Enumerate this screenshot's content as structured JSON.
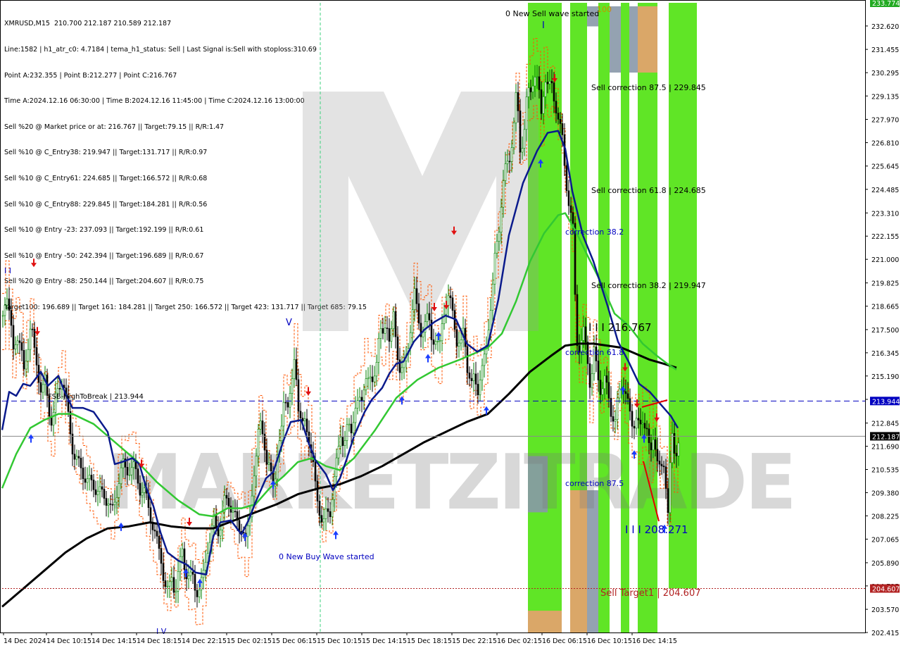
{
  "info_lines": [
    "XMRUSD,M15  210.700 212.187 210.589 212.187",
    "Line:1582 | h1_atr_c0: 4.7184 | tema_h1_status: Sell | Last Signal is:Sell with stoploss:310.69",
    "Point A:232.355 | Point B:212.277 | Point C:216.767",
    "Time A:2024.12.16 06:30:00 | Time B:2024.12.16 11:45:00 | Time C:2024.12.16 13:00:00",
    "Sell %20 @ Market price or at: 216.767 || Target:79.15 || R/R:1.47",
    "Sell %10 @ C_Entry38: 219.947 || Target:131.717 || R/R:0.97",
    "Sell %10 @ C_Entry61: 224.685 || Target:166.572 || R/R:0.68",
    "Sell %10 @ C_Entry88: 229.845 || Target:184.281 || R/R:0.56",
    "Sell %10 @ Entry -23: 237.093 || Target:192.199 || R/R:0.61",
    "Sell %10 @ Entry -50: 242.394 || Target:196.689 || R/R:0.67",
    "Sell %20 @ Entry -88: 250.144 || Target:204.607 || R/R:0.75",
    "Target100: 196.689 || Target 161: 184.281 || Target 250: 166.572 || Target 423: 131.717 || Target 685: 79.15"
  ],
  "chart_data": {
    "type": "candlestick",
    "symbol": "XMRUSD",
    "timeframe": "M15",
    "ylim": [
      202.415,
      233.774
    ],
    "y_ticks": [
      "232.620",
      "231.455",
      "230.295",
      "229.135",
      "227.970",
      "226.810",
      "225.645",
      "224.485",
      "223.310",
      "222.155",
      "221.000",
      "219.825",
      "218.665",
      "217.500",
      "216.345",
      "215.190",
      "214.025",
      "212.845",
      "211.690",
      "210.535",
      "209.380",
      "208.225",
      "207.065",
      "205.890",
      "204.735",
      "203.570",
      "202.415"
    ],
    "x_ticks": [
      "14 Dec 2024",
      "14 Dec 10:15",
      "14 Dec 14:15",
      "14 Dec 18:15",
      "14 Dec 22:15",
      "15 Dec 02:15",
      "15 Dec 06:15",
      "15 Dec 10:15",
      "15 Dec 14:15",
      "15 Dec 18:15",
      "15 Dec 22:15",
      "16 Dec 02:15",
      "16 Dec 06:15",
      "16 Dec 10:15",
      "16 Dec 14:15"
    ],
    "price_labels": {
      "top": "233.774",
      "resistance": "213.944",
      "current": "212.187",
      "target": "204.607"
    },
    "levels": {
      "resistance": 213.944,
      "current": 212.187,
      "target": 204.607
    },
    "annotations": {
      "new_sell": "0 New Sell wave started",
      "new_buy": "0 New Buy Wave started",
      "fsb": "FSB-HighToBreak | 213.944",
      "sell_corr_875": "Sell correction 87.5 | 229.845",
      "sell_corr_618": "Sell correction 61.8 | 224.685",
      "sell_corr_382": "Sell correction 38.2 | 219.947",
      "corr_382": "correction 38.2",
      "corr_618": "correction 61.8",
      "corr_875": "correction 87.5",
      "point_c": "I I I 216.767",
      "point_b": "I I I 208.271",
      "sell_target": "Sell Target1 | 204.607",
      "top_marker": "100",
      "watermark": "MARKETZITRADE"
    },
    "close_series": [
      [
        0,
        218.2
      ],
      [
        5,
        219.6
      ],
      [
        10,
        218.0
      ],
      [
        15,
        216.4
      ],
      [
        20,
        217.4
      ],
      [
        25,
        216.7
      ],
      [
        30,
        215.3
      ],
      [
        35,
        216.6
      ],
      [
        40,
        217.9
      ],
      [
        45,
        216.3
      ],
      [
        50,
        215.4
      ],
      [
        55,
        214.4
      ],
      [
        60,
        214.9
      ],
      [
        65,
        213.6
      ],
      [
        70,
        212.9
      ],
      [
        75,
        214.0
      ],
      [
        80,
        214.6
      ],
      [
        85,
        215.2
      ],
      [
        90,
        213.9
      ],
      [
        95,
        212.6
      ],
      [
        100,
        211.4
      ],
      [
        110,
        210.6
      ],
      [
        120,
        210.0
      ],
      [
        130,
        209.7
      ],
      [
        140,
        209.3
      ],
      [
        150,
        209.0
      ],
      [
        155,
        208.3
      ],
      [
        160,
        209.0
      ],
      [
        165,
        210.1
      ],
      [
        170,
        210.8
      ],
      [
        175,
        210.4
      ],
      [
        180,
        210.6
      ],
      [
        185,
        210.7
      ],
      [
        190,
        210.2
      ],
      [
        195,
        209.6
      ],
      [
        200,
        209.5
      ],
      [
        205,
        208.9
      ],
      [
        210,
        208.2
      ],
      [
        215,
        207.5
      ],
      [
        220,
        206.7
      ],
      [
        225,
        206.1
      ],
      [
        230,
        204.8
      ],
      [
        235,
        204.3
      ],
      [
        240,
        205.3
      ],
      [
        245,
        204.4
      ],
      [
        250,
        205.4
      ],
      [
        255,
        206.6
      ],
      [
        260,
        205.4
      ],
      [
        265,
        205.0
      ],
      [
        270,
        205.2
      ],
      [
        275,
        204.5
      ],
      [
        280,
        204.5
      ],
      [
        285,
        205.3
      ],
      [
        290,
        206.6
      ],
      [
        295,
        207.1
      ],
      [
        300,
        208.0
      ],
      [
        305,
        207.5
      ],
      [
        310,
        207.8
      ],
      [
        315,
        208.9
      ],
      [
        320,
        209.1
      ],
      [
        325,
        208.6
      ],
      [
        330,
        208.1
      ],
      [
        335,
        207.6
      ],
      [
        340,
        207.8
      ],
      [
        345,
        206.9
      ],
      [
        350,
        207.8
      ],
      [
        355,
        210.0
      ],
      [
        360,
        211.0
      ],
      [
        365,
        213.0
      ],
      [
        370,
        212.5
      ],
      [
        375,
        210.7
      ],
      [
        380,
        210.4
      ],
      [
        385,
        209.8
      ],
      [
        390,
        211.3
      ],
      [
        395,
        211.9
      ],
      [
        400,
        214.5
      ],
      [
        405,
        213.8
      ],
      [
        410,
        214.3
      ],
      [
        415,
        216.4
      ],
      [
        420,
        213.7
      ],
      [
        425,
        212.5
      ],
      [
        430,
        213.0
      ],
      [
        435,
        212.1
      ],
      [
        440,
        210.9
      ],
      [
        445,
        209.4
      ],
      [
        450,
        208.6
      ],
      [
        455,
        207.7
      ],
      [
        460,
        208.4
      ],
      [
        465,
        208.5
      ],
      [
        470,
        209.8
      ],
      [
        475,
        211.0
      ],
      [
        480,
        212.4
      ],
      [
        485,
        211.8
      ],
      [
        490,
        212.6
      ],
      [
        495,
        212.5
      ],
      [
        500,
        213.7
      ],
      [
        505,
        213.7
      ],
      [
        510,
        214.0
      ],
      [
        515,
        215.4
      ],
      [
        520,
        214.8
      ],
      [
        525,
        214.8
      ],
      [
        530,
        215.9
      ],
      [
        535,
        217.3
      ],
      [
        540,
        217.1
      ],
      [
        545,
        218.2
      ],
      [
        550,
        216.7
      ],
      [
        555,
        218.1
      ],
      [
        560,
        216.6
      ],
      [
        565,
        215.3
      ],
      [
        570,
        215.6
      ],
      [
        575,
        216.6
      ],
      [
        580,
        217.9
      ],
      [
        585,
        219.2
      ],
      [
        590,
        218.2
      ],
      [
        595,
        217.3
      ],
      [
        600,
        217.6
      ],
      [
        605,
        218.3
      ],
      [
        610,
        217.1
      ],
      [
        615,
        216.7
      ],
      [
        620,
        216.5
      ],
      [
        625,
        218.5
      ],
      [
        630,
        218.6
      ],
      [
        635,
        219.0
      ],
      [
        640,
        218.6
      ],
      [
        645,
        216.7
      ],
      [
        650,
        216.4
      ],
      [
        655,
        218.0
      ],
      [
        660,
        215.5
      ],
      [
        665,
        214.4
      ],
      [
        670,
        215.5
      ],
      [
        675,
        214.5
      ],
      [
        680,
        215.1
      ],
      [
        685,
        216.4
      ],
      [
        690,
        217.8
      ],
      [
        695,
        218.9
      ],
      [
        700,
        221.6
      ],
      [
        705,
        222.7
      ],
      [
        710,
        224.4
      ],
      [
        715,
        225.7
      ],
      [
        720,
        226.2
      ],
      [
        725,
        227.2
      ],
      [
        730,
        229.4
      ],
      [
        735,
        226.6
      ],
      [
        740,
        227.0
      ],
      [
        745,
        229.2
      ],
      [
        750,
        229.5
      ],
      [
        755,
        230.3
      ],
      [
        760,
        229.7
      ],
      [
        765,
        228.3
      ],
      [
        770,
        230.2
      ],
      [
        775,
        229.4
      ],
      [
        780,
        229.7
      ],
      [
        785,
        228.8
      ],
      [
        790,
        227.7
      ],
      [
        795,
        227.0
      ],
      [
        800,
        225.1
      ],
      [
        805,
        223.4
      ],
      [
        810,
        222.5
      ],
      [
        815,
        217.2
      ],
      [
        820,
        216.4
      ],
      [
        825,
        217.3
      ],
      [
        830,
        216.5
      ],
      [
        835,
        214.5
      ],
      [
        840,
        216.3
      ],
      [
        845,
        215.4
      ],
      [
        850,
        214.4
      ],
      [
        855,
        214.9
      ],
      [
        860,
        214.4
      ],
      [
        865,
        213.3
      ],
      [
        870,
        212.8
      ],
      [
        875,
        214.4
      ],
      [
        880,
        215.0
      ],
      [
        885,
        214.2
      ],
      [
        890,
        213.4
      ],
      [
        895,
        212.8
      ],
      [
        900,
        213.1
      ],
      [
        905,
        212.4
      ],
      [
        910,
        213.1
      ],
      [
        915,
        212.7
      ],
      [
        920,
        210.9
      ],
      [
        925,
        212.3
      ],
      [
        930,
        211.2
      ],
      [
        935,
        210.3
      ],
      [
        940,
        210.6
      ],
      [
        945,
        208.7
      ],
      [
        950,
        212.3
      ],
      [
        955,
        210.8
      ],
      [
        960,
        212.2
      ]
    ],
    "tema_series": [
      [
        0,
        212.5
      ],
      [
        10,
        214.4
      ],
      [
        20,
        214.2
      ],
      [
        30,
        214.8
      ],
      [
        40,
        214.7
      ],
      [
        55,
        215.4
      ],
      [
        65,
        214.7
      ],
      [
        80,
        215.2
      ],
      [
        90,
        214.3
      ],
      [
        100,
        213.6
      ],
      [
        115,
        213.6
      ],
      [
        130,
        213.4
      ],
      [
        150,
        212.4
      ],
      [
        160,
        210.8
      ],
      [
        170,
        210.9
      ],
      [
        185,
        211.1
      ],
      [
        195,
        210.8
      ],
      [
        205,
        209.6
      ],
      [
        215,
        208.7
      ],
      [
        225,
        207.4
      ],
      [
        235,
        206.4
      ],
      [
        250,
        206.0
      ],
      [
        262,
        205.8
      ],
      [
        275,
        205.4
      ],
      [
        290,
        205.3
      ],
      [
        300,
        207.2
      ],
      [
        310,
        207.9
      ],
      [
        325,
        208.0
      ],
      [
        340,
        207.3
      ],
      [
        350,
        208.0
      ],
      [
        360,
        208.9
      ],
      [
        375,
        210.1
      ],
      [
        385,
        210.4
      ],
      [
        400,
        212.0
      ],
      [
        410,
        212.9
      ],
      [
        425,
        213.0
      ],
      [
        435,
        211.9
      ],
      [
        445,
        211.0
      ],
      [
        460,
        210.3
      ],
      [
        470,
        209.5
      ],
      [
        480,
        210.1
      ],
      [
        490,
        211.1
      ],
      [
        500,
        212.2
      ],
      [
        515,
        213.4
      ],
      [
        525,
        214.0
      ],
      [
        540,
        214.6
      ],
      [
        550,
        215.3
      ],
      [
        560,
        215.8
      ],
      [
        570,
        215.9
      ],
      [
        585,
        216.9
      ],
      [
        600,
        217.5
      ],
      [
        615,
        217.9
      ],
      [
        630,
        218.2
      ],
      [
        645,
        218.0
      ],
      [
        660,
        216.8
      ],
      [
        675,
        216.4
      ],
      [
        690,
        216.7
      ],
      [
        705,
        219.0
      ],
      [
        720,
        222.2
      ],
      [
        740,
        224.8
      ],
      [
        760,
        226.4
      ],
      [
        775,
        227.3
      ],
      [
        790,
        227.4
      ],
      [
        800,
        226.5
      ],
      [
        810,
        224.4
      ],
      [
        825,
        222.2
      ],
      [
        840,
        220.9
      ],
      [
        860,
        218.7
      ],
      [
        875,
        216.9
      ],
      [
        890,
        215.9
      ],
      [
        905,
        214.8
      ],
      [
        920,
        214.4
      ],
      [
        935,
        213.8
      ],
      [
        950,
        213.2
      ],
      [
        960,
        212.6
      ]
    ],
    "ma_green_series": [
      [
        0,
        209.6
      ],
      [
        20,
        211.3
      ],
      [
        40,
        212.6
      ],
      [
        60,
        213.0
      ],
      [
        80,
        213.3
      ],
      [
        100,
        213.3
      ],
      [
        130,
        212.8
      ],
      [
        160,
        211.9
      ],
      [
        190,
        211.0
      ],
      [
        220,
        209.9
      ],
      [
        250,
        209.0
      ],
      [
        280,
        208.3
      ],
      [
        300,
        208.2
      ],
      [
        320,
        208.6
      ],
      [
        340,
        208.6
      ],
      [
        360,
        208.8
      ],
      [
        380,
        209.6
      ],
      [
        400,
        210.2
      ],
      [
        420,
        210.9
      ],
      [
        440,
        211.1
      ],
      [
        460,
        210.7
      ],
      [
        480,
        210.5
      ],
      [
        500,
        211.1
      ],
      [
        530,
        212.5
      ],
      [
        560,
        214.1
      ],
      [
        590,
        215.0
      ],
      [
        620,
        215.6
      ],
      [
        650,
        216.0
      ],
      [
        670,
        216.3
      ],
      [
        690,
        216.6
      ],
      [
        710,
        217.3
      ],
      [
        730,
        218.9
      ],
      [
        750,
        220.9
      ],
      [
        770,
        222.3
      ],
      [
        790,
        223.2
      ],
      [
        800,
        223.3
      ],
      [
        815,
        222.4
      ],
      [
        830,
        221.3
      ],
      [
        850,
        219.9
      ],
      [
        870,
        218.3
      ],
      [
        890,
        217.7
      ],
      [
        910,
        216.8
      ],
      [
        930,
        216.2
      ],
      [
        945,
        215.8
      ],
      [
        958,
        215.5
      ]
    ],
    "ma_black_series": [
      [
        0,
        203.7
      ],
      [
        30,
        204.6
      ],
      [
        60,
        205.5
      ],
      [
        90,
        206.4
      ],
      [
        120,
        207.1
      ],
      [
        150,
        207.6
      ],
      [
        180,
        207.7
      ],
      [
        210,
        207.9
      ],
      [
        240,
        207.7
      ],
      [
        270,
        207.6
      ],
      [
        300,
        207.6
      ],
      [
        330,
        208.0
      ],
      [
        360,
        208.4
      ],
      [
        390,
        208.8
      ],
      [
        420,
        209.3
      ],
      [
        450,
        209.6
      ],
      [
        480,
        209.8
      ],
      [
        510,
        210.2
      ],
      [
        540,
        210.7
      ],
      [
        570,
        211.3
      ],
      [
        600,
        211.9
      ],
      [
        630,
        212.4
      ],
      [
        660,
        212.9
      ],
      [
        690,
        213.3
      ],
      [
        720,
        214.3
      ],
      [
        750,
        215.4
      ],
      [
        780,
        216.2
      ],
      [
        800,
        216.7
      ],
      [
        820,
        216.8
      ],
      [
        840,
        216.8
      ],
      [
        860,
        216.7
      ],
      [
        880,
        216.6
      ],
      [
        900,
        216.3
      ],
      [
        920,
        216.0
      ],
      [
        940,
        215.8
      ],
      [
        958,
        215.6
      ]
    ],
    "vertical_bands": [
      {
        "x1": 750,
        "x2": 798,
        "color": "#44e000"
      },
      {
        "x1": 810,
        "x2": 834,
        "color": "#44e000"
      },
      {
        "x1": 850,
        "x2": 866,
        "color": "#44e000"
      },
      {
        "x1": 882,
        "x2": 894,
        "color": "#44e000"
      },
      {
        "x1": 906,
        "x2": 934,
        "color": "#44e000"
      },
      {
        "x1": 950,
        "x2": 990,
        "color": "#44e000",
        "y_min": 204.607
      }
    ],
    "colors": {
      "bull_candle": "#008000",
      "bear_candle": "#000000",
      "tema": "#0a1a8c",
      "ma_green": "#32c832",
      "ma_black": "#000000",
      "resistance_line": "#0000c0",
      "target_line": "#b22222",
      "orange_channel": "#ff5500",
      "price_box_blue": "#0000c0",
      "price_box_red": "#b22222",
      "grid": "#c0c0c0"
    }
  }
}
